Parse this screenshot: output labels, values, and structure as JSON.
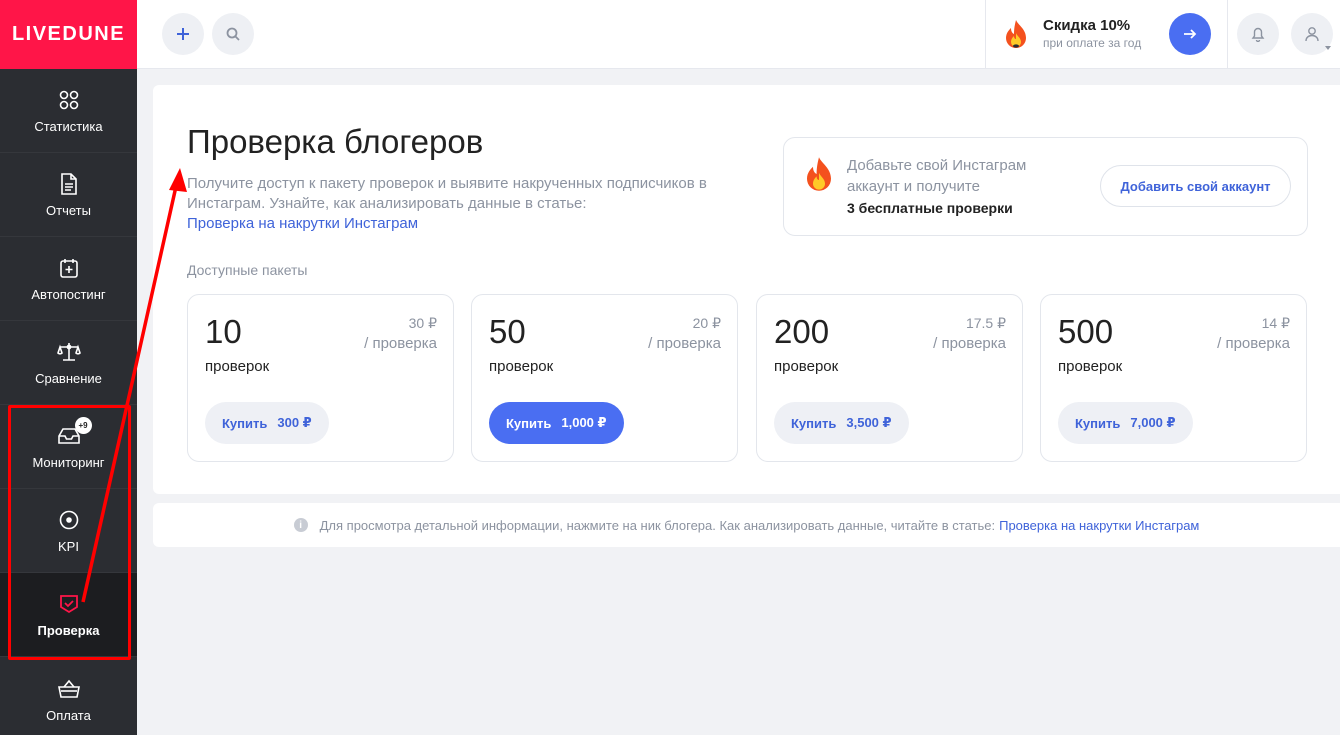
{
  "sidebar": {
    "logo": "LIVEDUNE",
    "items": [
      {
        "label": "Статистика",
        "icon": "stats-icon"
      },
      {
        "label": "Отчеты",
        "icon": "document-icon"
      },
      {
        "label": "Автопостинг",
        "icon": "calendar-plus-icon"
      },
      {
        "label": "Сравнение",
        "icon": "scales-icon"
      },
      {
        "label": "Мониторинг",
        "icon": "inbox-icon",
        "badge": "+9"
      },
      {
        "label": "KPI",
        "icon": "target-icon"
      },
      {
        "label": "Проверка",
        "icon": "shield-check-icon",
        "active": true
      },
      {
        "label": "Оплата",
        "icon": "basket-icon"
      }
    ]
  },
  "topbar": {
    "promo_title": "Скидка 10%",
    "promo_subtitle": "при оплате за год"
  },
  "main": {
    "title": "Проверка блогеров",
    "description": "Получите доступ к пакету проверок и выявите накрученных подписчиков в Инстаграм. Узнайте, как анализировать данные в статье:",
    "description_link": "Проверка на накрутки Инстаграм",
    "info": {
      "line1": "Добавьте свой Инстаграм",
      "line2": "аккаунт и получите",
      "line3": "3 бесплатные проверки",
      "button": "Добавить свой аккаунт"
    },
    "packs_label": "Доступные пакеты",
    "packs": [
      {
        "count": "10",
        "unit": "проверок",
        "price": "30 ₽",
        "per": "/ проверка",
        "buy": "Купить",
        "total": "300 ₽",
        "primary": false
      },
      {
        "count": "50",
        "unit": "проверок",
        "price": "20 ₽",
        "per": "/ проверка",
        "buy": "Купить",
        "total": "1,000 ₽",
        "primary": true
      },
      {
        "count": "200",
        "unit": "проверок",
        "price": "17.5 ₽",
        "per": "/ проверка",
        "buy": "Купить",
        "total": "3,500 ₽",
        "primary": false
      },
      {
        "count": "500",
        "unit": "проверок",
        "price": "14 ₽",
        "per": "/ проверка",
        "buy": "Купить",
        "total": "7,000 ₽",
        "primary": false
      }
    ]
  },
  "note": {
    "icon_text": "i",
    "text": "Для просмотра детальной информации, нажмите на ник блогера. Как анализировать данные, читайте в статье:",
    "link": "Проверка на накрутки Инстаграм"
  },
  "colors": {
    "brand": "#ff1548",
    "accent": "#4a6ef2",
    "sidebar": "#2b2d32",
    "annotation": "#ff0000"
  }
}
